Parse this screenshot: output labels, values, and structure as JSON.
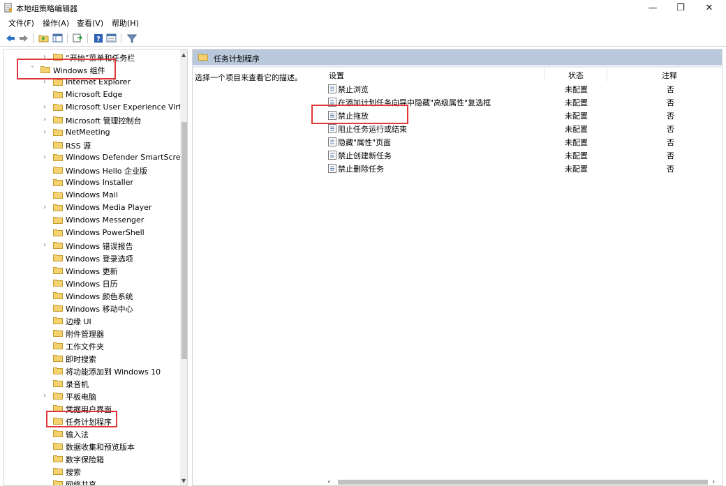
{
  "window": {
    "title": "本地组策略编辑器",
    "minimize_glyph": "—",
    "maximize_glyph": "❐",
    "close_glyph": "✕"
  },
  "menu": [
    "文件(F)",
    "操作(A)",
    "查看(V)",
    "帮助(H)"
  ],
  "toolbar": {
    "buttons": [
      "back-icon",
      "forward-icon",
      "up-folder-icon",
      "show-hide-tree-icon",
      "export-list-icon",
      "help-icon",
      "properties-icon",
      "filter-icon"
    ]
  },
  "tree": {
    "items": [
      {
        "label": "“开始”菜单和任务栏",
        "expander": "›",
        "indent": 1
      },
      {
        "label": "Windows 组件",
        "expander": "˅",
        "indent": 0
      },
      {
        "label": "Internet Explorer",
        "expander": "›",
        "indent": 1
      },
      {
        "label": "Microsoft Edge",
        "expander": "",
        "indent": 1
      },
      {
        "label": "Microsoft User Experience Virt",
        "expander": "›",
        "indent": 1
      },
      {
        "label": "Microsoft 管理控制台",
        "expander": "›",
        "indent": 1
      },
      {
        "label": "NetMeeting",
        "expander": "›",
        "indent": 1
      },
      {
        "label": "RSS 源",
        "expander": "",
        "indent": 1
      },
      {
        "label": "Windows Defender SmartScre",
        "expander": "›",
        "indent": 1
      },
      {
        "label": "Windows Hello 企业版",
        "expander": "",
        "indent": 1
      },
      {
        "label": "Windows Installer",
        "expander": "",
        "indent": 1
      },
      {
        "label": "Windows Mail",
        "expander": "",
        "indent": 1
      },
      {
        "label": "Windows Media Player",
        "expander": "›",
        "indent": 1
      },
      {
        "label": "Windows Messenger",
        "expander": "",
        "indent": 1
      },
      {
        "label": "Windows PowerShell",
        "expander": "",
        "indent": 1
      },
      {
        "label": "Windows 错误报告",
        "expander": "›",
        "indent": 1
      },
      {
        "label": "Windows 登录选项",
        "expander": "",
        "indent": 1
      },
      {
        "label": "Windows 更新",
        "expander": "",
        "indent": 1
      },
      {
        "label": "Windows 日历",
        "expander": "",
        "indent": 1
      },
      {
        "label": "Windows 颜色系统",
        "expander": "",
        "indent": 1
      },
      {
        "label": "Windows 移动中心",
        "expander": "",
        "indent": 1
      },
      {
        "label": "边缘 UI",
        "expander": "",
        "indent": 1
      },
      {
        "label": "附件管理器",
        "expander": "",
        "indent": 1
      },
      {
        "label": "工作文件夹",
        "expander": "",
        "indent": 1
      },
      {
        "label": "即时搜索",
        "expander": "",
        "indent": 1
      },
      {
        "label": "将功能添加到 Windows 10",
        "expander": "",
        "indent": 1
      },
      {
        "label": "录音机",
        "expander": "",
        "indent": 1
      },
      {
        "label": "平板电脑",
        "expander": "›",
        "indent": 1
      },
      {
        "label": "凭据用户界面",
        "expander": "",
        "indent": 1
      },
      {
        "label": "任务计划程序",
        "expander": "",
        "indent": 1
      },
      {
        "label": "输入法",
        "expander": "",
        "indent": 1
      },
      {
        "label": "数据收集和预览版本",
        "expander": "",
        "indent": 1
      },
      {
        "label": "数字保险箱",
        "expander": "",
        "indent": 1
      },
      {
        "label": "搜索",
        "expander": "",
        "indent": 1
      },
      {
        "label": "网络共享",
        "expander": "",
        "indent": 1
      }
    ]
  },
  "detail": {
    "header_title": "任务计划程序",
    "description": "选择一个项目来查看它的描述。",
    "columns": {
      "setting": "设置",
      "state": "状态",
      "comment": "注释"
    },
    "settings": [
      {
        "label": "禁止浏览",
        "state": "未配置",
        "comment": "否"
      },
      {
        "label": "在添加计划任务向导中隐藏\"高级属性\"复选框",
        "state": "未配置",
        "comment": "否"
      },
      {
        "label": "禁止拖放",
        "state": "未配置",
        "comment": "否"
      },
      {
        "label": "阻止任务运行或结束",
        "state": "未配置",
        "comment": "否"
      },
      {
        "label": "隐藏\"属性\"页面",
        "state": "未配置",
        "comment": "否"
      },
      {
        "label": "禁止创建新任务",
        "state": "未配置",
        "comment": "否"
      },
      {
        "label": "禁止删除任务",
        "state": "未配置",
        "comment": "否"
      }
    ]
  },
  "colors": {
    "highlight": "#e0363a",
    "header_bg": "#b9c9db",
    "folder_yellow": "#f3d26f"
  }
}
